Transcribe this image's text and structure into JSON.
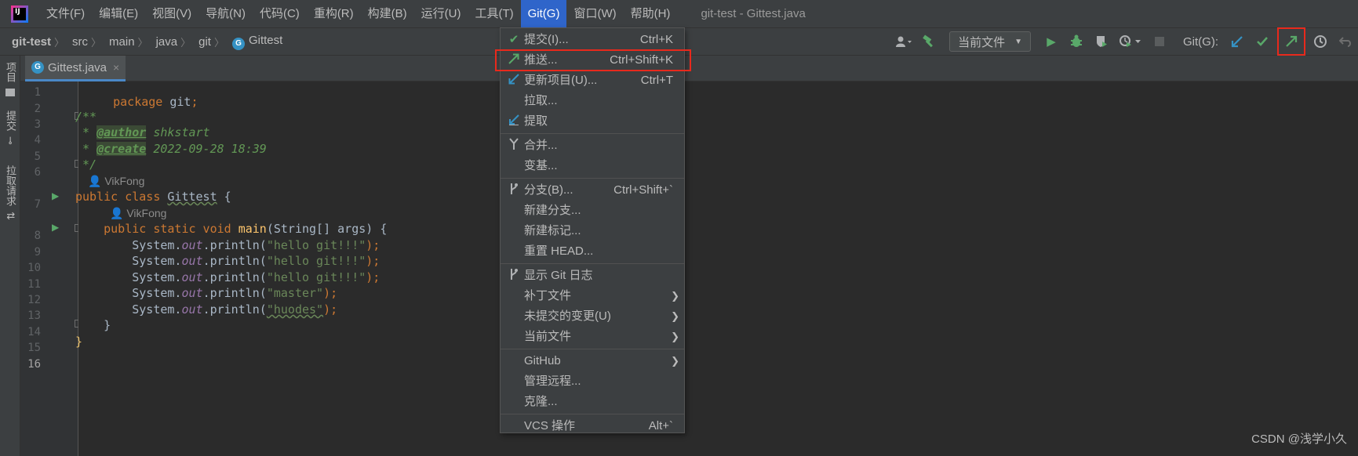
{
  "menubar": {
    "items": [
      "文件(F)",
      "编辑(E)",
      "视图(V)",
      "导航(N)",
      "代码(C)",
      "重构(R)",
      "构建(B)",
      "运行(U)",
      "工具(T)",
      "Git(G)",
      "窗口(W)",
      "帮助(H)"
    ],
    "active_index": 9,
    "window_title": "git-test - Gittest.java"
  },
  "breadcrumb": {
    "project": "git-test",
    "parts": [
      "src",
      "main",
      "java",
      "git"
    ],
    "file": "Gittest"
  },
  "toolbar": {
    "run_config": "当前文件",
    "git_label": "Git(G):",
    "icons": [
      "user-icon",
      "build-hammer-icon",
      "run-icon",
      "debug-icon",
      "coverage-icon",
      "profile-icon",
      "stop-icon",
      "git-update-icon",
      "git-commit-icon",
      "git-push-icon",
      "history-icon",
      "rollback-icon"
    ]
  },
  "left_stripe": {
    "project": "项目",
    "commit": "提交",
    "pull_requests": "拉取请求"
  },
  "tab": {
    "label": "Gittest.java",
    "close": "×"
  },
  "editor": {
    "line_numbers": [
      "1",
      "2",
      "3",
      "4",
      "5",
      "6",
      "7",
      "8",
      "9",
      "10",
      "11",
      "12",
      "13",
      "14",
      "15",
      "16"
    ],
    "author_hint": "VikFong",
    "line1": {
      "kw": "package",
      "rest": " git",
      "semi": ";"
    },
    "doc_open": "/**",
    "doc_author_prefix": " * ",
    "doc_author_tag": "@author",
    "doc_author_val": " shkstart",
    "doc_create_prefix": " * ",
    "doc_create_tag": "@create",
    "doc_create_val": " 2022-09-28 18:39",
    "doc_close": " */",
    "class_kw": "public class ",
    "class_name": "Gittest",
    "class_brace": " {",
    "main_kw": "    public static void ",
    "main_name": "main",
    "main_args": "(String[] args) {",
    "println_prefix": "        System.",
    "println_out": "out",
    "println_mid": ".println(",
    "println_end": ");",
    "strings": [
      "\"hello git!!!\"",
      "\"hello git!!!\"",
      "\"hello git!!!\"",
      "\"master\"",
      "\"huodes\""
    ],
    "close_inner": "    }",
    "close_outer": "}"
  },
  "git_menu": {
    "commit": {
      "label": "提交(I)...",
      "shortcut": "Ctrl+K"
    },
    "push": {
      "label": "推送...",
      "shortcut": "Ctrl+Shift+K"
    },
    "update": {
      "label": "更新项目(U)...",
      "shortcut": "Ctrl+T"
    },
    "pull": {
      "label": "拉取..."
    },
    "fetch": {
      "label": "提取"
    },
    "merge": {
      "label": "合并..."
    },
    "rebase": {
      "label": "变基..."
    },
    "branches": {
      "label": "分支(B)...",
      "shortcut": "Ctrl+Shift+`"
    },
    "new_branch": {
      "label": "新建分支..."
    },
    "new_tag": {
      "label": "新建标记..."
    },
    "reset_head": {
      "label": "重置 HEAD..."
    },
    "show_log": {
      "label": "显示 Git 日志"
    },
    "patch": {
      "label": "补丁文件"
    },
    "uncommitted": {
      "label": "未提交的变更(U)"
    },
    "current_file": {
      "label": "当前文件"
    },
    "github": {
      "label": "GitHub"
    },
    "manage_remotes": {
      "label": "管理远程..."
    },
    "clone": {
      "label": "克隆..."
    },
    "vcs_ops": {
      "label": "VCS 操作",
      "shortcut": "Alt+`"
    }
  },
  "watermark": "CSDN @浅学小久",
  "colors": {
    "highlight_red": "#e8291c",
    "menu_active": "#2f65ca",
    "git_green": "#59a869",
    "git_blue": "#3592c4"
  }
}
